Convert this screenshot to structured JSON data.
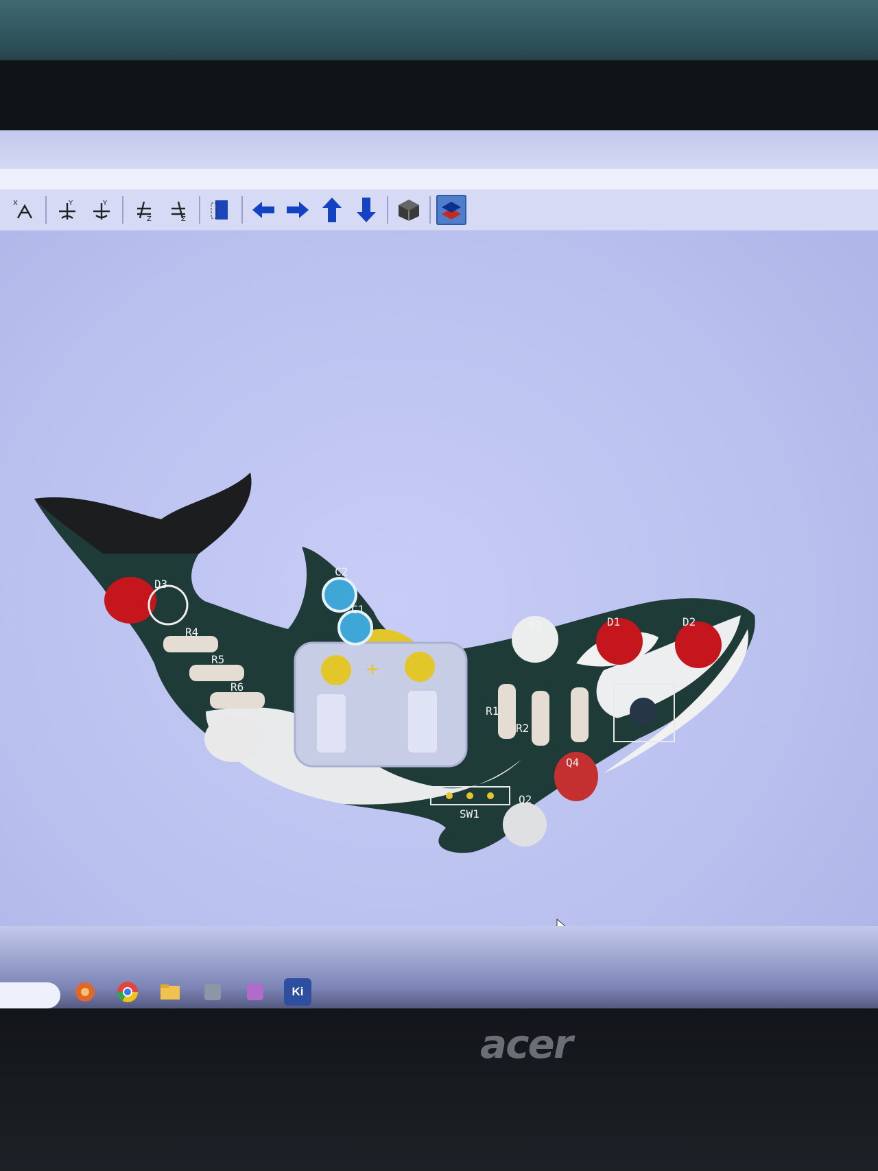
{
  "toolbar": {
    "buttons": [
      {
        "name": "rotate-x-ccw-icon",
        "label": "X"
      },
      {
        "name": "rotate-y-cw-icon",
        "label": "Y"
      },
      {
        "name": "rotate-y-ccw-icon",
        "label": "Y"
      },
      {
        "name": "rotate-z-cw-icon",
        "label": "Z"
      },
      {
        "name": "rotate-z-ccw-icon",
        "label": "Z"
      },
      {
        "name": "flip-board-icon"
      },
      {
        "name": "move-left-icon"
      },
      {
        "name": "move-right-icon"
      },
      {
        "name": "move-up-icon"
      },
      {
        "name": "move-down-icon"
      },
      {
        "name": "orthographic-cube-icon"
      },
      {
        "name": "layers-toggle-icon",
        "active": true
      }
    ]
  },
  "board": {
    "refs": {
      "d3": "D3",
      "r4": "R4",
      "r5": "R5",
      "r6": "R6",
      "c2": "C2",
      "c1": "C1",
      "q3": "Q3",
      "r1": "R1",
      "r2": "R2",
      "d1": "D1",
      "d2": "D2",
      "q4": "Q4",
      "q2": "Q2",
      "sw1": "SW1"
    },
    "battery_plus": "+"
  },
  "taskbar": {
    "apps": [
      {
        "name": "app-icon-orange"
      },
      {
        "name": "chrome-icon"
      },
      {
        "name": "file-explorer-icon"
      },
      {
        "name": "app-icon-gray"
      },
      {
        "name": "app-icon-purple"
      },
      {
        "name": "kicad-icon",
        "label": "Ki"
      }
    ]
  },
  "brand": "acer",
  "colors": {
    "board": "#1f3b38",
    "silkscreen": "#f0f0f0",
    "led_red": "#c4161c",
    "pad_gold": "#e3c72a",
    "accent": "#4f7ecb"
  }
}
